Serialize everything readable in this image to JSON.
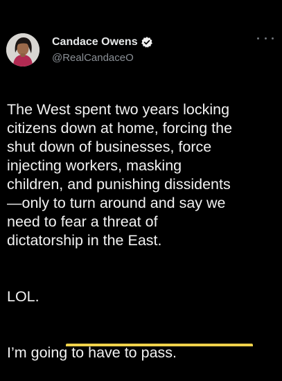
{
  "author": {
    "display_name": "Candace Owens",
    "handle": "@RealCandaceO",
    "verified": true,
    "avatar_icon": "profile-photo",
    "verified_icon": "verified-badge-icon",
    "verified_color": "#1d9bf0"
  },
  "menu_icon": "more-options-icon",
  "tweet": {
    "paragraph_1": "The West spent two years locking\ncitizens down at home, forcing the\nshut down of businesses, force\ninjecting workers, masking\nchildren, and punishing dissidents\n—only to turn around and say we\nneed to fear a threat of\ndictatorship in the East.",
    "paragraph_2": "LOL.",
    "paragraph_3": "I’m going to have to pass."
  },
  "colors": {
    "background": "#000000",
    "text": "#f2f2f2",
    "handle": "#8b9096",
    "accent_strip": "#f0d24a"
  }
}
